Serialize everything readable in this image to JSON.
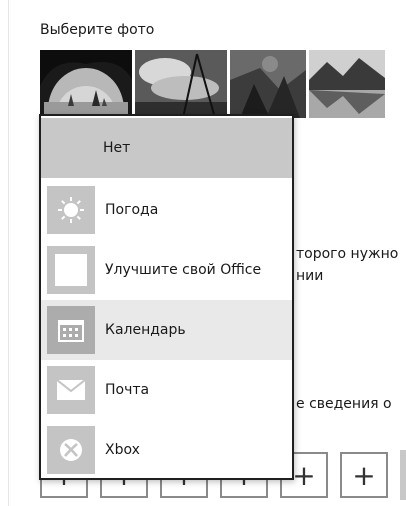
{
  "lock_screen": {
    "choose_photo_label": "Выберите фото",
    "partial_text_1": "торого нужно",
    "partial_text_2": "нии",
    "partial_text_3": "е сведения о"
  },
  "app_picker": {
    "items": [
      {
        "label": "Нет",
        "icon": "none",
        "hovered": false
      },
      {
        "label": "Погода",
        "icon": "sun-icon",
        "hovered": false
      },
      {
        "label": "Улучшите свой Office",
        "icon": "office-icon",
        "hovered": false
      },
      {
        "label": "Календарь",
        "icon": "calendar-icon",
        "hovered": true
      },
      {
        "label": "Почта",
        "icon": "mail-icon",
        "hovered": false
      },
      {
        "label": "Xbox",
        "icon": "xbox-icon",
        "hovered": false
      }
    ]
  },
  "colors": {
    "accent_selected": "#c8c8c8",
    "hover": "#e9e9e9",
    "tile": "#c4c4c4"
  }
}
